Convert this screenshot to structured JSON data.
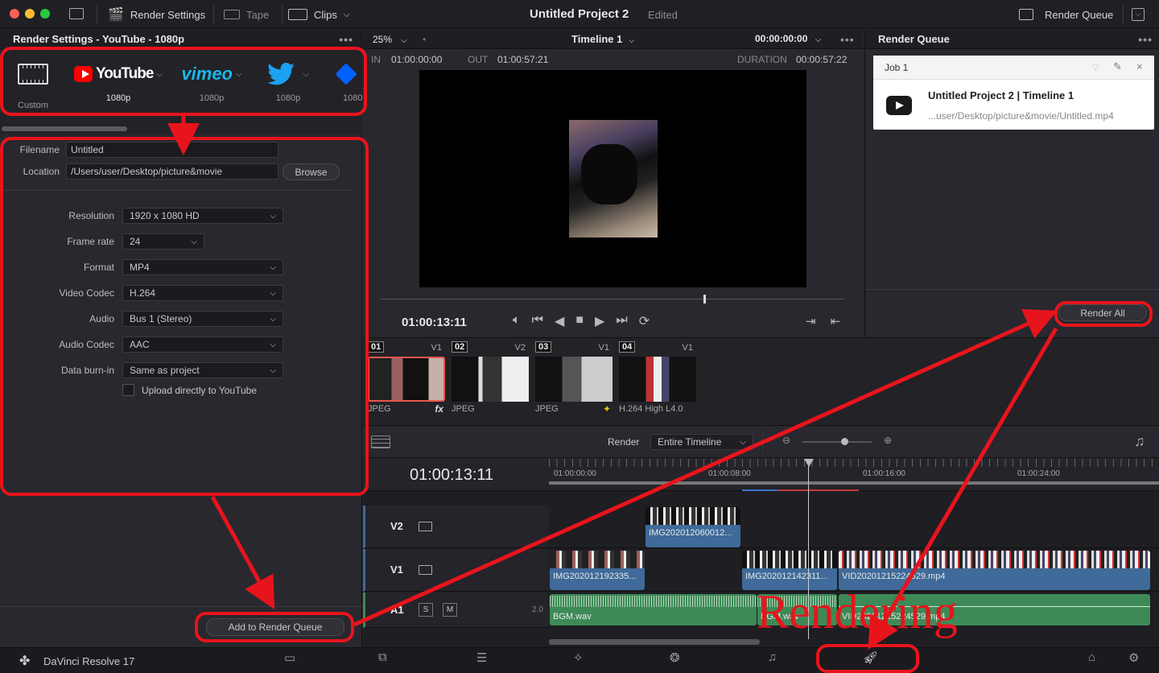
{
  "titlebar": {
    "render_settings": "Render Settings",
    "tape": "Tape",
    "clips": "Clips",
    "project": "Untitled Project 2",
    "edited": "Edited",
    "render_queue": "Render Queue"
  },
  "render_settings": {
    "header": "Render Settings - YouTube - 1080p",
    "presets": [
      {
        "name": "Custom",
        "label": "Custom"
      },
      {
        "name": "YouTube",
        "label": "1080p"
      },
      {
        "name": "vimeo",
        "label": "1080p"
      },
      {
        "name": "Twitter",
        "label": "1080p"
      },
      {
        "name": "Dropbox",
        "label": "1080"
      }
    ],
    "filename_label": "Filename",
    "filename": "Untitled",
    "location_label": "Location",
    "location": "/Users/user/Desktop/picture&movie",
    "browse": "Browse",
    "rows": [
      {
        "label": "Resolution",
        "value": "1920 x 1080 HD"
      },
      {
        "label": "Frame rate",
        "value": "24"
      },
      {
        "label": "Format",
        "value": "MP4"
      },
      {
        "label": "Video Codec",
        "value": "H.264"
      },
      {
        "label": "Audio",
        "value": "Bus 1 (Stereo)"
      },
      {
        "label": "Audio Codec",
        "value": "AAC"
      },
      {
        "label": "Data burn-in",
        "value": "Same as project"
      }
    ],
    "upload_label": "Upload directly to YouTube",
    "add_to_queue": "Add to Render Queue"
  },
  "viewer": {
    "zoom": "25%",
    "timeline": "Timeline 1",
    "timecode_top": "00:00:00:00",
    "in_label": "IN",
    "in": "01:00:00:00",
    "out_label": "OUT",
    "out": "01:00:57:21",
    "duration_label": "DURATION",
    "duration": "00:00:57:22",
    "current": "01:00:13:11"
  },
  "queue": {
    "header": "Render Queue",
    "job": "Job 1",
    "title": "Untitled Project 2 | Timeline 1",
    "path": "...user/Desktop/picture&movie/Untitled.mp4",
    "render_all": "Render All"
  },
  "clips": [
    {
      "num": "01",
      "track": "V1",
      "codec": "JPEG",
      "fx": "fx"
    },
    {
      "num": "02",
      "track": "V2",
      "codec": "JPEG",
      "fx": ""
    },
    {
      "num": "03",
      "track": "V1",
      "codec": "JPEG",
      "fx": "✦"
    },
    {
      "num": "04",
      "track": "V1",
      "codec": "H.264 High L4.0",
      "fx": ""
    }
  ],
  "timeline": {
    "render_label": "Render",
    "render_value": "Entire Timeline",
    "timecode": "01:00:13:11",
    "ruler": [
      "01:00:00:00",
      "01:00:08:00",
      "01:00:16:00",
      "01:00:24:00"
    ],
    "tracks": {
      "v2": "V2",
      "v1": "V1",
      "a1": "A1",
      "s": "S",
      "m": "M",
      "level": "2.0"
    },
    "clip_names": {
      "v2a": "IMG202012060012...",
      "v1a": "IMG202012192335...",
      "v1b": "IMG202012142311...",
      "v1c": "VID20201215224529.mp4",
      "a1a": "BGM.wav",
      "a1b": "BGM.wav",
      "a1c": "VID20201215224529.mp4"
    }
  },
  "annotation": "Rendering",
  "footer": {
    "app": "DaVinci Resolve 17"
  },
  "colors": {
    "accent": "#e8141c",
    "video_clip": "#3f6a99",
    "audio_clip": "#3e8a57"
  }
}
